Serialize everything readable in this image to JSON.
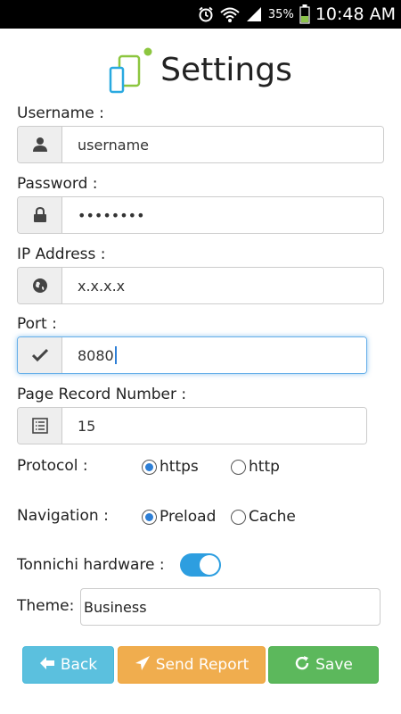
{
  "status_bar": {
    "battery_percent": "35%",
    "time": "10:48 AM",
    "icons": [
      "alarm-icon",
      "wifi-icon",
      "signal-icon",
      "battery-icon"
    ]
  },
  "header": {
    "title": "Settings",
    "logo_icon": "devices-logo-icon"
  },
  "fields": {
    "username": {
      "label": "Username :",
      "value": "username",
      "icon": "user-icon"
    },
    "password": {
      "label": "Password :",
      "value": "••••••••",
      "icon": "lock-icon"
    },
    "ip_address": {
      "label": "IP Address :",
      "value": "x.x.x.x",
      "icon": "globe-icon"
    },
    "port": {
      "label": "Port :",
      "value": "8080",
      "icon": "check-icon"
    },
    "page_record_number": {
      "label": "Page Record Number :",
      "value": "15",
      "icon": "list-icon"
    }
  },
  "protocol": {
    "label": "Protocol :",
    "options": [
      "https",
      "http"
    ],
    "selected": "https"
  },
  "navigation": {
    "label": "Navigation :",
    "options": [
      "Preload",
      "Cache"
    ],
    "selected": "Preload"
  },
  "hardware": {
    "label": "Tonnichi hardware :",
    "enabled": true
  },
  "theme": {
    "label": "Theme:",
    "value": "Business"
  },
  "buttons": {
    "back": "Back",
    "send_report": "Send Report",
    "save": "Save"
  },
  "colors": {
    "back": "#5bc0de",
    "send_report": "#f0ad4e",
    "save": "#5cb85c",
    "toggle": "#2d9ee0",
    "radio_selected": "#2e7fd6",
    "logo_green": "#8cc63f",
    "logo_blue": "#29a9e0"
  }
}
